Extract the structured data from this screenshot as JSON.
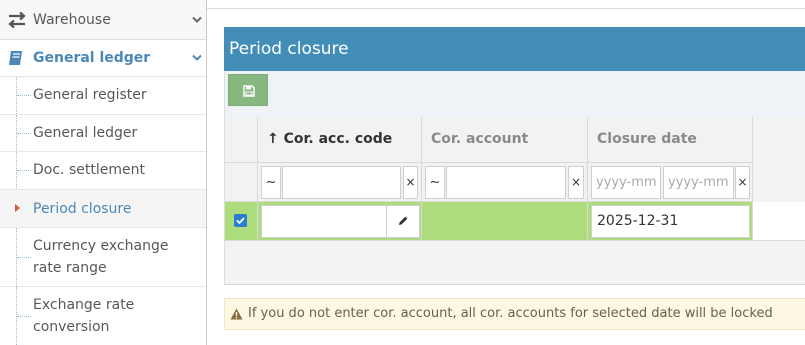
{
  "sidebar": {
    "warehouse": {
      "label": "Warehouse",
      "icon": "exchange-arrows-icon"
    },
    "general_ledger": {
      "label": "General ledger",
      "icon": "book-icon"
    },
    "items": [
      {
        "label": "General register"
      },
      {
        "label": "General ledger"
      },
      {
        "label": "Doc. settlement"
      },
      {
        "label": "Period closure",
        "active": true
      },
      {
        "label": "Currency exchange rate range"
      },
      {
        "label": "Exchange rate conversion"
      }
    ]
  },
  "panel": {
    "title": "Period closure",
    "toolbar": {
      "save_icon": "floppy-disk-icon"
    }
  },
  "grid": {
    "columns": [
      {
        "label": "Cor. acc. code",
        "sort_indicator": "↑"
      },
      {
        "label": "Cor. account"
      },
      {
        "label": "Closure date"
      }
    ],
    "filters": {
      "operator": "~",
      "clear": "×",
      "date_from_placeholder": "yyyy-mm",
      "date_to_placeholder": "yyyy-mm"
    },
    "rows": [
      {
        "selected": true,
        "cor_acc_code": "",
        "cor_account": "",
        "closure_date": "2025-12-31"
      }
    ]
  },
  "warning": {
    "text": "If you do not enter cor. account, all cor. accounts for selected date will be locked"
  },
  "colors": {
    "header_blue": "#438eb9",
    "active_text": "#4b88b7",
    "save_green": "#87b87f",
    "row_selected": "#addc7d",
    "warning_bg": "#fcf8e3"
  }
}
